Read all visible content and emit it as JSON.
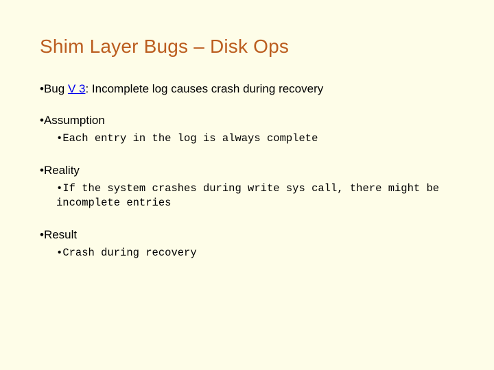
{
  "title": "Shim Layer Bugs – Disk Ops",
  "dot": "• ",
  "bug": {
    "prefix": "Bug ",
    "link": "V 3",
    "suffix": ": Incomplete log causes crash during recovery"
  },
  "assumption": {
    "heading": "Assumption",
    "detail": "Each entry in the log is always complete"
  },
  "reality": {
    "heading": "Reality",
    "detail": "If the system crashes during write sys call, there might be incomplete entries"
  },
  "result": {
    "heading": "Result",
    "detail": "Crash during recovery"
  }
}
